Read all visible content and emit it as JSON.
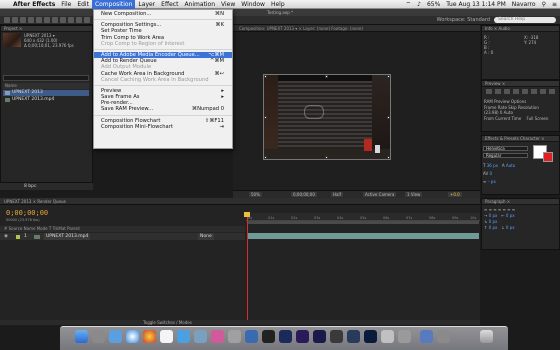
{
  "menubar": {
    "app": "After Effects",
    "items": [
      "File",
      "Edit",
      "Composition",
      "Layer",
      "Effect",
      "Animation",
      "View",
      "Window",
      "Help"
    ],
    "active": "Composition",
    "battery": "65%",
    "datetime": "Tue Aug 13  1:14 PM",
    "user": "Navarro"
  },
  "window": {
    "title": "Testing.aep *"
  },
  "toolbar": {
    "workspace_label": "Workspace:",
    "workspace_value": "Standard",
    "search_placeholder": "Search Help"
  },
  "project": {
    "tab": "Project ×",
    "comp_name": "UPNEXT 2013 ▾",
    "comp_size": "640 x 432  (1.00)",
    "comp_duration": "Δ 0;00;10;01, 23.976 fps",
    "header": "Name",
    "items": [
      {
        "name": "UPNEXT 2013",
        "selected": true
      },
      {
        "name": "UPNEXT 2013.mp4",
        "selected": false
      }
    ],
    "bpc": "8 bpc"
  },
  "viewer": {
    "tabs": "Composition: UPNEXT 2013 ▾   ×   Layer: (none)        Footage: (none)",
    "zoom": "50%",
    "timecode": "0;00;00;00",
    "resolution": "Half",
    "camera": "Active Camera",
    "views": "1 View",
    "exposure": "+0.0"
  },
  "menu": {
    "items": [
      {
        "label": "New Composition...",
        "shortcut": "⌘N",
        "disabled": false,
        "highlighted": false,
        "sep_after": true
      },
      {
        "label": "Composition Settings...",
        "shortcut": "⌘K",
        "disabled": false,
        "highlighted": false,
        "sep_after": false
      },
      {
        "label": "Set Poster Time",
        "shortcut": "",
        "disabled": false,
        "highlighted": false,
        "sep_after": false
      },
      {
        "label": "Trim Comp to Work Area",
        "shortcut": "",
        "disabled": false,
        "highlighted": false,
        "sep_after": false
      },
      {
        "label": "Crop Comp to Region of Interest",
        "shortcut": "",
        "disabled": true,
        "highlighted": false,
        "sep_after": true
      },
      {
        "label": "Add to Adobe Media Encoder Queue...",
        "shortcut": "⌥⌘M",
        "disabled": false,
        "highlighted": true,
        "sep_after": false
      },
      {
        "label": "Add to Render Queue",
        "shortcut": "^⌘M",
        "disabled": false,
        "highlighted": false,
        "sep_after": false
      },
      {
        "label": "Add Output Module",
        "shortcut": "",
        "disabled": true,
        "highlighted": false,
        "sep_after": false
      },
      {
        "label": "Cache Work Area in Background",
        "shortcut": "⌘↩",
        "disabled": false,
        "highlighted": false,
        "sep_after": false
      },
      {
        "label": "Cancel Caching Work Area in Background",
        "shortcut": "",
        "disabled": true,
        "highlighted": false,
        "sep_after": true
      },
      {
        "label": "Preview",
        "shortcut": "▸",
        "disabled": false,
        "highlighted": false,
        "sep_after": false
      },
      {
        "label": "Save Frame As",
        "shortcut": "▸",
        "disabled": false,
        "highlighted": false,
        "sep_after": false
      },
      {
        "label": "Pre-render...",
        "shortcut": "",
        "disabled": false,
        "highlighted": false,
        "sep_after": false
      },
      {
        "label": "Save RAM Preview...",
        "shortcut": "⌘Numpad 0",
        "disabled": false,
        "highlighted": false,
        "sep_after": true
      },
      {
        "label": "Composition Flowchart",
        "shortcut": "⇧⌘F11",
        "disabled": false,
        "highlighted": false,
        "sep_after": false
      },
      {
        "label": "Composition Mini-Flowchart",
        "shortcut": "⇥",
        "disabled": false,
        "highlighted": false,
        "sep_after": false
      }
    ]
  },
  "info": {
    "tab": "Info ×   Audio",
    "x": "X: -318",
    "y": "Y: 274",
    "r": "R :",
    "g": "G :",
    "b": "B :",
    "a": "A : 0"
  },
  "preview": {
    "tab": "Preview ×",
    "ram_options": "RAM Preview Options",
    "frame_rate_label": "Frame Rate  Skip   Resolution",
    "frame_rate": "(23.98)  0     Auto",
    "from_current": "From Current Time",
    "full_screen": "Full Screen"
  },
  "character": {
    "tab": "Effects & Presets    Character ×",
    "font": "Helvetica",
    "style": "Regular",
    "size": "36 px",
    "leading": "Auto",
    "tracking": "0",
    "stroke": "– px"
  },
  "paragraph": {
    "tab": "Paragraph ×",
    "indent1": "0 px",
    "indent2": "0 px",
    "indent3": "0 px",
    "space1": "0 px",
    "space2": "0 px"
  },
  "timeline": {
    "tabs": "UPNEXT 2013 ×   Render Queue",
    "timecode": "0;00;00;00",
    "sub": "00000 (23.976 fps)",
    "col_head": "#   Source Name              Mode   T  TrkMat       Parent",
    "layer_num": "1",
    "layer_name": "UPNEXT 2013.mp4",
    "layer_parent": "None",
    "ticks": [
      "0s",
      "01s",
      "02s",
      "03s",
      "04s",
      "05s",
      "06s",
      "07s",
      "08s",
      "09s",
      "10s"
    ],
    "toggle_label": "Toggle Switches / Modes"
  },
  "colors": {
    "accent": "#3d72d6",
    "timecode": "#e8a838",
    "layer_bar": "#6f9a97",
    "playhead": "#d03030"
  }
}
